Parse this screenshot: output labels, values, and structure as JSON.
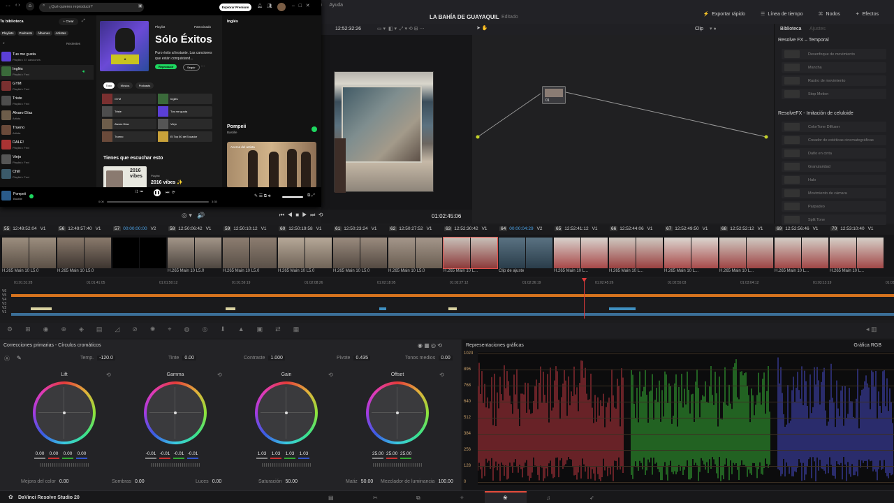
{
  "resolve": {
    "menu": [
      "ajo",
      "Ayuda"
    ],
    "project_title": "LA BAHÍA DE GUAYAQUIL",
    "project_status": "Editado",
    "top_right": [
      {
        "icon": "lightning-icon",
        "label": "Exportar rápido"
      },
      {
        "icon": "timeline-icon",
        "label": "Línea de tiempo"
      },
      {
        "icon": "nodes-icon",
        "label": "Nodos"
      },
      {
        "icon": "effects-icon",
        "label": "Efectos"
      }
    ],
    "viewer": {
      "timecode": "12:52:32:26",
      "clip_label": "Clip",
      "playhead_time": "01:02:45:06"
    },
    "library": {
      "tab_active": "Biblioteca",
      "tab_inactive": "Ajustes",
      "section1": "Resolve FX – Temporal",
      "section1_items": [
        "Desenfoque de movimiento",
        "Mancha",
        "Rastro de movimiento",
        "Stop Motion"
      ],
      "section2": "ResolveFX - Imitación de celuloide",
      "section2_items": [
        "ColorTone Diffuser",
        "Creador de estéticas cinematográficas",
        "Daño en cinta",
        "Granularidad",
        "Halo",
        "Movimiento de cámara",
        "Parpadeo",
        "Split Tone"
      ]
    },
    "node": {
      "label": "01"
    },
    "timeline_header": [
      {
        "num": "55",
        "tc": "12:49:52:04",
        "track": "V1"
      },
      {
        "num": "56",
        "tc": "12:49:57:40",
        "track": "V1"
      },
      {
        "num": "57",
        "tc": "00:00:00:00",
        "track": "V2",
        "blue": true
      },
      {
        "num": "58",
        "tc": "12:50:06:42",
        "track": "V1"
      },
      {
        "num": "59",
        "tc": "12:50:10:12",
        "track": "V1"
      },
      {
        "num": "60",
        "tc": "12:50:19:58",
        "track": "V1"
      },
      {
        "num": "61",
        "tc": "12:50:23:24",
        "track": "V1"
      },
      {
        "num": "62",
        "tc": "12:50:27:52",
        "track": "V1"
      },
      {
        "num": "63",
        "tc": "12:52:30:42",
        "track": "V1"
      },
      {
        "num": "64",
        "tc": "00:00:04:29",
        "track": "V2",
        "blue": true
      },
      {
        "num": "65",
        "tc": "12:52:41:12",
        "track": "V1"
      },
      {
        "num": "66",
        "tc": "12:52:44:06",
        "track": "V1"
      },
      {
        "num": "67",
        "tc": "12:52:49:50",
        "track": "V1"
      },
      {
        "num": "68",
        "tc": "12:52:52:12",
        "track": "V1"
      },
      {
        "num": "69",
        "tc": "12:52:56:46",
        "track": "V1"
      },
      {
        "num": "70",
        "tc": "12:53:10:40",
        "track": "V1"
      }
    ],
    "clip_labels": [
      "H.265 Main 10 L5.0",
      "H.265 Main 10 L5.0",
      "",
      "H.265 Main 10 L5.0",
      "H.265 Main 10 L5.0",
      "H.265 Main 10 L5.0",
      "H.265 Main 10 L5.0",
      "H.265 Main 10 L5.0",
      "H.265 Main 10 L...",
      "Clip de ajuste",
      "H.265 Main 10 L...",
      "H.265 Main 10 L...",
      "H.265 Main 10 L...",
      "H.265 Main 10 L...",
      "H.265 Main 10 L...",
      "H.265 Main 10 L..."
    ],
    "ruler": [
      "01:01:31:28",
      "01:01:41:05",
      "01:01:50:12",
      "01:01:59:19",
      "01:02:08:26",
      "01:02:18:05",
      "01:02:27:12",
      "01:02:36:19",
      "01:02:45:26",
      "01:02:55:03",
      "01:03:04:12",
      "01:03:13:19",
      "01:03:22:"
    ],
    "tracks": [
      "V6",
      "V5",
      "V4",
      "V3",
      "V2",
      "V1"
    ],
    "color": {
      "panel_title": "Correcciones primarias - Círculos cromáticos",
      "params": [
        {
          "label": "Temp.",
          "value": "-120.0"
        },
        {
          "label": "Tinte",
          "value": "0.00"
        },
        {
          "label": "Contraste",
          "value": "1.000"
        },
        {
          "label": "Pivote",
          "value": "0.435"
        },
        {
          "label": "Tonos medios",
          "value": "0.00"
        }
      ],
      "wheels": [
        {
          "name": "Lift",
          "values": [
            "0.00",
            "0.00",
            "0.00",
            "0.00"
          ]
        },
        {
          "name": "Gamma",
          "values": [
            "-0.01",
            "-0.01",
            "-0.01",
            "-0.01"
          ]
        },
        {
          "name": "Gain",
          "values": [
            "1.03",
            "1.03",
            "1.03",
            "1.03"
          ]
        },
        {
          "name": "Offset",
          "values": [
            "25.00",
            "25.00",
            "25.00"
          ]
        }
      ],
      "bottom": [
        {
          "label": "Mejora del color",
          "value": "0.00"
        },
        {
          "label": "Sombras",
          "value": "0.00"
        },
        {
          "label": "Luces",
          "value": "0.00"
        },
        {
          "label": "Saturación",
          "value": "50.00"
        },
        {
          "label": "Matiz",
          "value": "50.00"
        },
        {
          "label": "Mezclador de luminancia",
          "value": "100.00"
        }
      ]
    },
    "scopes": {
      "title": "Representaciones gráficas",
      "mode": "Gráfica RGB",
      "y_labels": [
        "1023",
        "896",
        "768",
        "640",
        "512",
        "384",
        "256",
        "128",
        "0"
      ]
    },
    "app_name": "DaVinci Resolve Studio 20"
  },
  "spotify": {
    "search_placeholder": "¿Qué quieres reproducir?",
    "explore_premium": "Explorar Premium",
    "library_title": "Tu biblioteca",
    "create": "Crear",
    "filters": [
      "Playlists",
      "Podcasts",
      "Álbumes",
      "Artistas"
    ],
    "recents": "Recientes",
    "library_items": [
      {
        "title": "Tus me gusta",
        "sub": "Playlist • 37 canciones",
        "color": "#5b3fd6"
      },
      {
        "title": "Inglés",
        "sub": "Playlist • Fevi",
        "color": "#3a6a3a",
        "green": true
      },
      {
        "title": "GYM",
        "sub": "Playlist • Fevi",
        "color": "#7a3030"
      },
      {
        "title": "Triste",
        "sub": "Playlist • Fevi",
        "color": "#4d4d4d"
      },
      {
        "title": "Alvaro Díaz",
        "sub": "Artista",
        "color": "#6d5d4a"
      },
      {
        "title": "Trueno",
        "sub": "Artista",
        "color": "#6a4a3a"
      },
      {
        "title": "DALE!",
        "sub": "Playlist • Fevi",
        "color": "#a33"
      },
      {
        "title": "Viejo",
        "sub": "Playlist • Fevi",
        "color": "#555"
      },
      {
        "title": "Chill",
        "sub": "Playlist • Fevi",
        "color": "#3b5a6a"
      }
    ],
    "hero": {
      "type": "Playlist",
      "title": "Sólo Éxitos",
      "desc": "Puro éxito al instante. Las canciones que están conquistand...",
      "play": "Reproducir",
      "follow": "Seguir",
      "sponsored": "Patrocinado"
    },
    "chips": [
      "Todo",
      "Música",
      "Podcasts"
    ],
    "grid": [
      {
        "title": "GYM",
        "color": "#7a3030"
      },
      {
        "title": "Inglés",
        "color": "#3a6a3a"
      },
      {
        "title": "Triste",
        "color": "#4d4d4d"
      },
      {
        "title": "Tus me gusta",
        "color": "#5b3fd6"
      },
      {
        "title": "Alvaro Díaz",
        "color": "#6d5d4a"
      },
      {
        "title": "Viejo",
        "color": "#555"
      },
      {
        "title": "Trueno",
        "color": "#6a4a3a"
      },
      {
        "title": "El Top 50 de Ecuador",
        "color": "#c9a23a"
      }
    ],
    "section": "Tienes que escuchar esto",
    "rec": {
      "type": "Playlist",
      "title": "2016 vibes ✨",
      "cover_text": "2016 vibes"
    },
    "right_title": "Inglés",
    "now_artist_card": {
      "title": "Pompeii",
      "sub": "Bastille",
      "about": "Acerca del artista"
    },
    "player": {
      "title": "Pompeii",
      "artist": "Bastille",
      "elapsed": "0:00",
      "total": "3:35"
    }
  }
}
